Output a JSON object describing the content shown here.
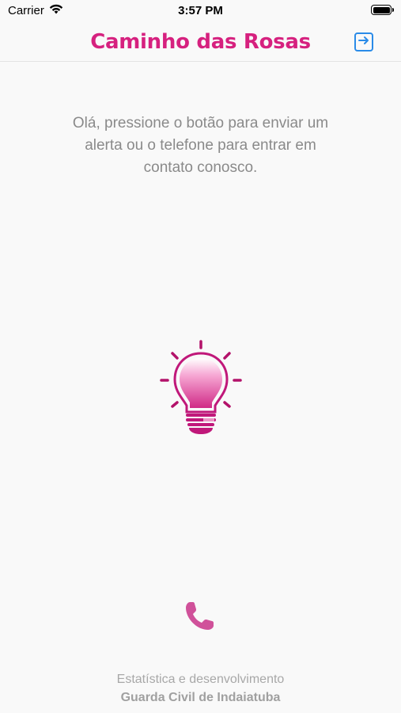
{
  "status_bar": {
    "carrier": "Carrier",
    "time": "3:57 PM"
  },
  "nav": {
    "title": "Caminho das Rosas",
    "logout_icon": "logout-arrow-icon"
  },
  "message": "Olá, pressione o botão para enviar um alerta ou o telefone para entrar em contato conosco.",
  "alert_button": {
    "icon": "lightbulb-icon"
  },
  "phone_button": {
    "icon": "phone-icon"
  },
  "footer": {
    "line1": "Estatística e desenvolvimento",
    "line2": "Guarda Civil de Indaiatuba"
  },
  "colors": {
    "brand": "#d6217f",
    "accent_blue": "#2a8be8",
    "text_muted": "#8a8a8a",
    "background": "#f9f9f9"
  }
}
